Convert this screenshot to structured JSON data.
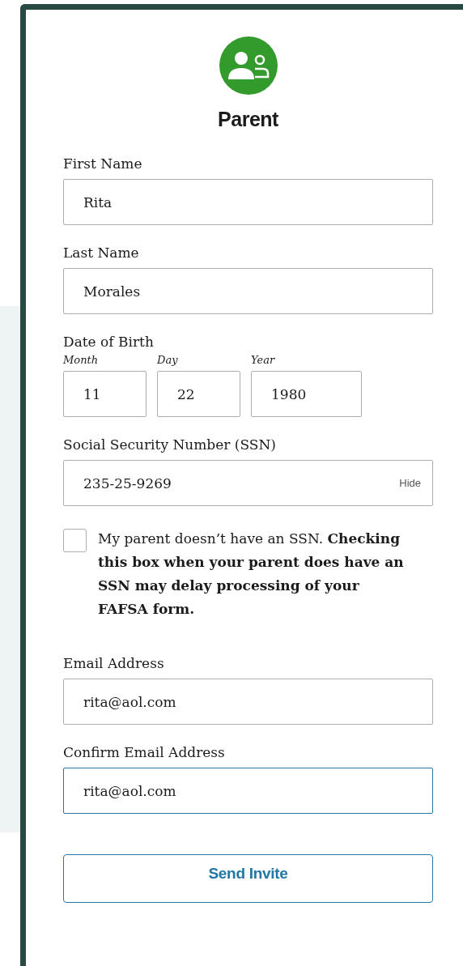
{
  "header": {
    "title": "Parent"
  },
  "fields": [
    {
      "kind": "text",
      "label": "First Name",
      "value": "Rita",
      "focused": false
    },
    {
      "kind": "text",
      "label": "Last Name",
      "value": "Morales",
      "focused": false
    },
    {
      "kind": "date",
      "label": "Date of Birth",
      "parts": [
        {
          "label": "Month",
          "value": "11"
        },
        {
          "label": "Day",
          "value": "22"
        },
        {
          "label": "Year",
          "value": "1980"
        }
      ]
    },
    {
      "kind": "secret",
      "label": "Social Security Number (SSN)",
      "value": "235-25-9269",
      "action": "Hide",
      "focused": false
    },
    {
      "kind": "checkbox",
      "text": "My parent doesn’t have an SSN. **Checking this box when your parent does have an SSN may delay processing of your FAFSA form.**",
      "checked": false
    },
    {
      "kind": "text",
      "label": "Email Address",
      "value": "rita@aol.com",
      "focused": false
    },
    {
      "kind": "text",
      "label": "Confirm Email Address",
      "value": "rita@aol.com",
      "focused": true
    }
  ],
  "button": {
    "label": "Send Invite"
  }
}
